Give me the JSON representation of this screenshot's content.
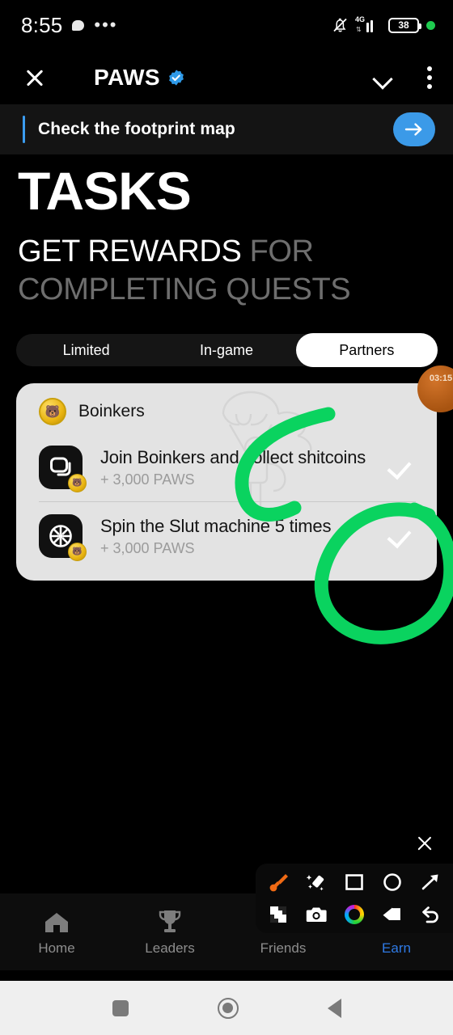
{
  "status_bar": {
    "time": "8:55",
    "network": "4G",
    "battery_level": "38",
    "icons": [
      "chat-bubble-icon",
      "more-dots-icon",
      "bell-muted-icon",
      "signal-bars-icon",
      "battery-icon",
      "recording-dot-icon"
    ]
  },
  "app_header": {
    "title": "PAWS",
    "verified": true,
    "close_icon": "close-icon",
    "chevron_icon": "chevron-down-icon",
    "menu_icon": "kebab-menu-icon"
  },
  "banner": {
    "text": "Check the footprint map",
    "action_icon": "arrow-right-icon",
    "accent_color": "#3b9ae8"
  },
  "hero": {
    "title": "TASKS",
    "subtitle_highlight": "GET REWARDS",
    "subtitle_rest": " FOR COMPLETING QUESTS"
  },
  "tabs": {
    "items": [
      {
        "label": "Limited",
        "active": false
      },
      {
        "label": "In-game",
        "active": false
      },
      {
        "label": "Partners",
        "active": true
      }
    ]
  },
  "timer_badge": {
    "value": "03:15"
  },
  "task_card": {
    "brand": "Boinkers",
    "brand_icon": "boinkers-coin-icon",
    "tasks": [
      {
        "title": "Join Boinkers and collect shitcoins",
        "reward": "+ 3,000 PAWS",
        "icon": "app-window-icon",
        "status_icon": "checkmark-icon"
      },
      {
        "title": "Spin the Slut machine 5 times",
        "reward": "+ 3,000 PAWS",
        "icon": "spin-wheel-icon",
        "status_icon": "checkmark-icon"
      }
    ]
  },
  "annotation": {
    "color": "#0ad35f",
    "shapes": [
      "curve-stroke",
      "circle-stroke"
    ]
  },
  "markup_toolbar": {
    "close_icon": "close-icon",
    "tools": [
      {
        "name": "brush-icon",
        "color": "#f06a14"
      },
      {
        "name": "magic-highlighter-icon",
        "color": "#ffffff"
      },
      {
        "name": "square-icon",
        "color": "#ffffff"
      },
      {
        "name": "circle-icon",
        "color": "#ffffff"
      },
      {
        "name": "arrow-icon",
        "color": "#ffffff"
      },
      {
        "name": "mosaic-icon",
        "color": "#ffffff"
      },
      {
        "name": "camera-icon",
        "color": "#ffffff"
      },
      {
        "name": "color-wheel-icon",
        "color": "#ffffff"
      },
      {
        "name": "eraser-icon",
        "color": "#ffffff"
      },
      {
        "name": "undo-icon",
        "color": "#ffffff"
      }
    ]
  },
  "bottom_nav": {
    "items": [
      {
        "label": "Home",
        "icon": "home-icon",
        "active": false
      },
      {
        "label": "Leaders",
        "icon": "trophy-icon",
        "active": false
      },
      {
        "label": "Friends",
        "icon": "people-icon",
        "active": false
      },
      {
        "label": "Earn",
        "icon": "earn-icon",
        "active": true
      }
    ],
    "active_color": "#2f7ae5"
  },
  "system_nav": {
    "buttons": [
      "recents-square-icon",
      "home-circle-icon",
      "back-triangle-icon"
    ]
  }
}
